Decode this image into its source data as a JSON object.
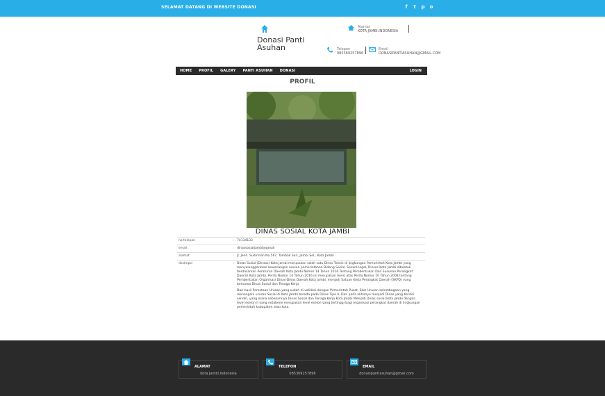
{
  "topbar": {
    "welcome": "SELAMAT DATANG DI WEBSITE DONASI",
    "social": [
      {
        "icon": "facebook-icon",
        "glyph": "f"
      },
      {
        "icon": "twitter-icon",
        "glyph": "t"
      },
      {
        "icon": "pinterest-icon",
        "glyph": "p"
      },
      {
        "icon": "instagram-icon",
        "glyph": "o"
      }
    ]
  },
  "header": {
    "logo_title": "Donasi Panti Asuhan",
    "logo_icon": "house-icon",
    "alamat": {
      "label": "Alamat",
      "value": "KOTA JAMBI,INDONESIA"
    },
    "telepon": {
      "label": "Telepon",
      "value": "085369257896"
    },
    "email": {
      "label": "Email",
      "value": "DONASIPANTIASUHAN@GMAIL.COM"
    }
  },
  "nav": {
    "items": [
      "HOME",
      "PROFIL",
      "GALERY",
      "PANTI ASUHAN",
      "DONASI"
    ],
    "login": "LOGIN"
  },
  "page": {
    "title": "PROFIL",
    "photo_caption": "DINAS SOSIAL KOTA JAMBI"
  },
  "profile": {
    "rows": [
      {
        "key": "no telepon",
        "value": "74134133"
      },
      {
        "key": "email",
        "value": "dinassosialjambi@gmail"
      },
      {
        "key": "alamat",
        "value": "Jl. Jend. Sudirman No.567, Tambak Sari, Jambi Sel., Kota Jambi"
      }
    ],
    "deskripsi_key": "deskripsi",
    "deskripsi": [
      "Dinas Sosial (Dinsos) Kota Jambi merupakan salah satu Dinas Teknis di lingkungan Pemerintah Kota Jambi yang menyelenggarakan kewenangan urusan pemerintahan Bidang Sosial. Secara legal, Dinsos Kota Jambi dibentuk berdasarkan Peraturan Daerah Kota Jambi Nomor 14 Tahun 2016 Tentang Pembentukan Dan Susunan Perangkat Daerah Kota Jambi. Perda Nomor 14 Tahun 2016 ini merupakan revisi atas Perda Nomor 10 Tahun 2008 tentang Pembentukan Organisasi Dinas-Dinas Daerah Kota Jambi, menjadi Satuan Kerja Perangkat Daerah (SKPD) yang bernama Dinas Sosial dan Tenaga Kerja.",
      "Dari hasil Pemetaan Urusan yang sudah di validasi dengan Pemerintah Pusat, Skor Urusan kelembagaan yang menangani urusan Sosial di Kota Jambi berada pada Dinas Tipe A. Dan pada akhirnya menjadi Dinas yang berdiri sendiri, yang mana sebelumnya Dinas Sosial dan Tenaga Kerja Kota Jmabi Menjadi Dinas sosial kota jambi dengan level eselon II yang notabene merupakan level eselon yang tertinggi bagi organisasi perangkat daerah di lingkungan pemerintah kabupaten atau kota."
    ]
  },
  "footer": {
    "boxes": [
      {
        "icon": "house-icon",
        "label": "ALAMAT",
        "value": "Kota Jambi,Indonesia"
      },
      {
        "icon": "phone-icon",
        "label": "TELEFON",
        "value": "085369257896"
      },
      {
        "icon": "mail-icon",
        "label": "EMAIL",
        "value": "donasipantiasuhan@gmail.com"
      }
    ]
  },
  "colors": {
    "accent": "#29aee8",
    "nav": "#2b2b2b",
    "footer": "#2a2a2a"
  }
}
